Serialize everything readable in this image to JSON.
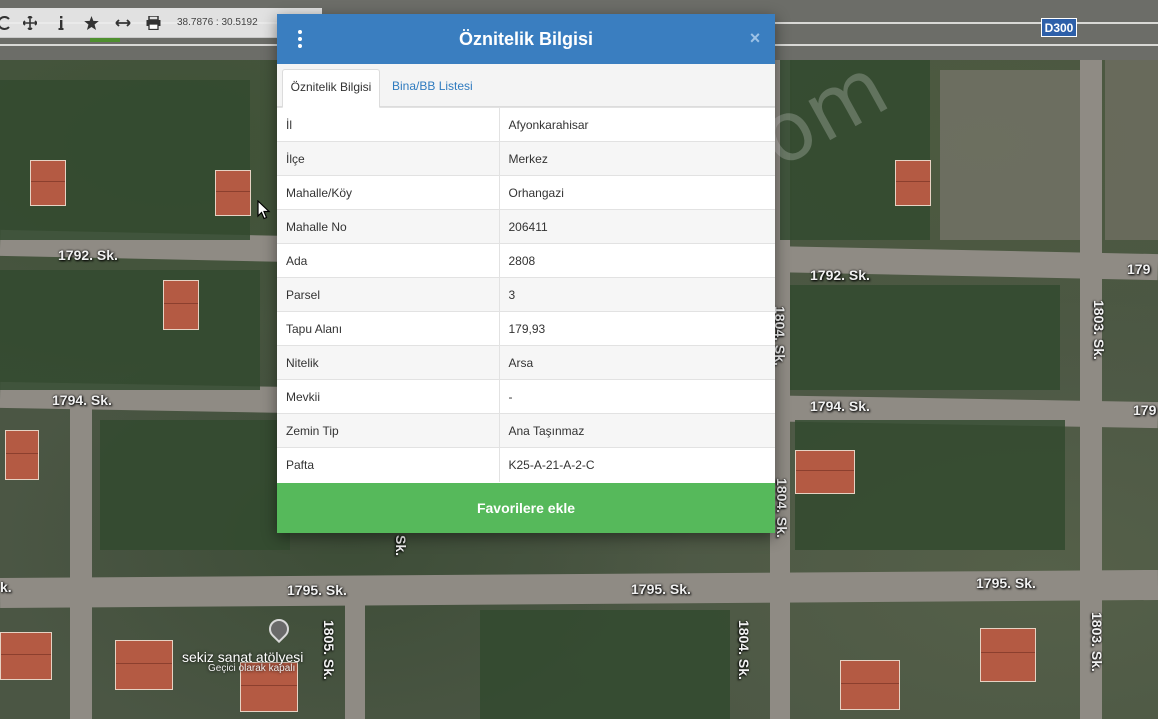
{
  "toolbar": {
    "coords": "38.7876 : 30.5192",
    "tools": [
      "refresh-icon",
      "move-icon",
      "info-icon",
      "star-icon",
      "measure-icon",
      "print-icon"
    ]
  },
  "map": {
    "road_sign": "D300",
    "street_labels": {
      "s1792_left": "1792. Sk.",
      "s1792_right": "1792. Sk.",
      "s1792_edge": "179",
      "s1794_left": "1794. Sk.",
      "s1794_right": "1794. Sk.",
      "s1794_edge": "179",
      "s1795_left": "1795. Sk.",
      "s1795_mid": "1795. Sk.",
      "s1795_right": "1795. Sk.",
      "s1804_top": "1804. Sk.",
      "s1804_mid": "1804. Sk.",
      "s1804_bottom": "1804. Sk.",
      "s1803_top": "1803. Sk.",
      "s1803_bottom": "1803. Sk.",
      "s1805": "1805. Sk.",
      "sk_fragment": "Sk.",
      "left_fragment": "k."
    },
    "poi": {
      "name": "sekiz sanat atölyesi",
      "status": "Geçici olarak kapalı"
    }
  },
  "modal": {
    "title": "Öznitelik Bilgisi",
    "close_label": "×",
    "tabs": [
      {
        "label": "Öznitelik Bilgisi",
        "active": true
      },
      {
        "label": "Bina/BB Listesi",
        "active": false
      }
    ],
    "rows": [
      {
        "key": "İl",
        "value": "Afyonkarahisar"
      },
      {
        "key": "İlçe",
        "value": "Merkez"
      },
      {
        "key": "Mahalle/Köy",
        "value": "Orhangazi"
      },
      {
        "key": "Mahalle No",
        "value": "206411"
      },
      {
        "key": "Ada",
        "value": "2808"
      },
      {
        "key": "Parsel",
        "value": "3"
      },
      {
        "key": "Tapu Alanı",
        "value": "179,93"
      },
      {
        "key": "Nitelik",
        "value": "Arsa"
      },
      {
        "key": "Mevkii",
        "value": "-"
      },
      {
        "key": "Zemin Tip",
        "value": "Ana Taşınmaz"
      },
      {
        "key": "Pafta",
        "value": "K25-A-21-A-2-C"
      }
    ],
    "favorite_button": "Favorilere ekle"
  },
  "watermark": "emlakjet.com",
  "colors": {
    "header": "#3a7ec0",
    "favorite": "#56b95b",
    "tab_link": "#2f7bbf"
  }
}
